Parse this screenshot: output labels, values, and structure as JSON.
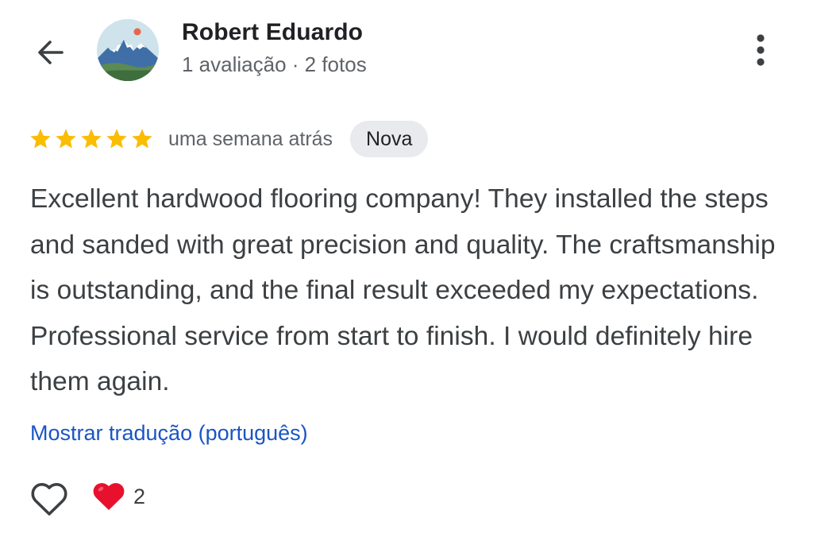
{
  "reviewer": {
    "name": "Robert Eduardo",
    "meta": "1 avaliação · 2 fotos"
  },
  "icons": {
    "back": "back-arrow-icon",
    "more": "more-vertical-icon",
    "star": "star-icon",
    "like": "heart-outline-icon",
    "reaction": "red-heart-icon"
  },
  "review": {
    "rating": 5,
    "date": "uma semana atrás",
    "badge": "Nova",
    "text": "Excellent hardwood flooring company! They installed the steps and sanded with great precision and quality. The craftsmanship is outstanding, and the final result exceeded my expectations. Professional service from start to finish. I would definitely hire them again.",
    "translate_link": "Mostrar tradução (português)"
  },
  "reactions": {
    "heart_count": "2"
  },
  "colors": {
    "star": "#FBBC04",
    "link": "#1A55C4",
    "heart": "#E8112D",
    "badge_bg": "#E8EAED"
  }
}
